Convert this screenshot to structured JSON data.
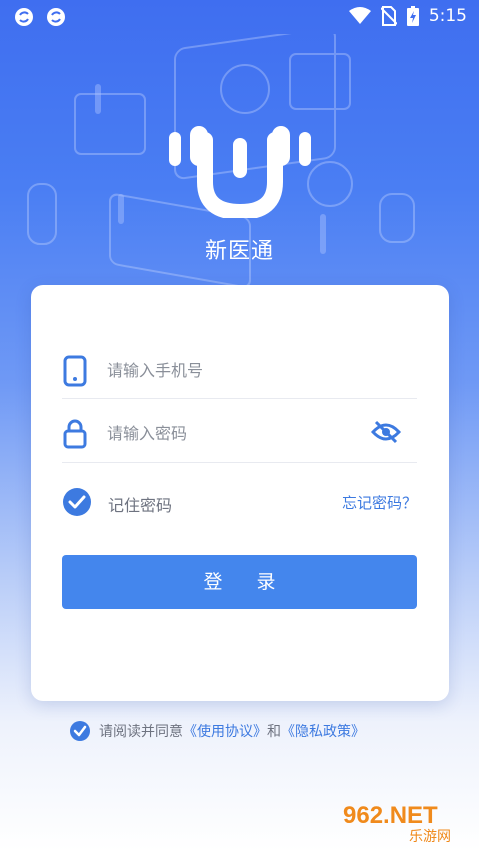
{
  "status_bar": {
    "time": "5:15",
    "left_icons": [
      "sync-icon",
      "sync-icon"
    ],
    "right_icons": [
      "wifi-icon",
      "no-sim-icon",
      "battery-charging-icon"
    ]
  },
  "app": {
    "name": "新医通"
  },
  "login": {
    "phone_placeholder": "请输入手机号",
    "password_placeholder": "请输入密码",
    "remember_label": "记住密码",
    "forgot_label": "忘记密码？",
    "login_button": "登录"
  },
  "agreement": {
    "prefix": "请阅读并同意",
    "terms": "《使用协议》",
    "and": "和",
    "privacy": "《隐私政策》"
  },
  "watermark": {
    "text": "962.NET",
    "sub": "乐游网"
  },
  "colors": {
    "accent": "#4486ed",
    "link": "#3d7ae0",
    "bg_top": "#3f6ef0"
  }
}
